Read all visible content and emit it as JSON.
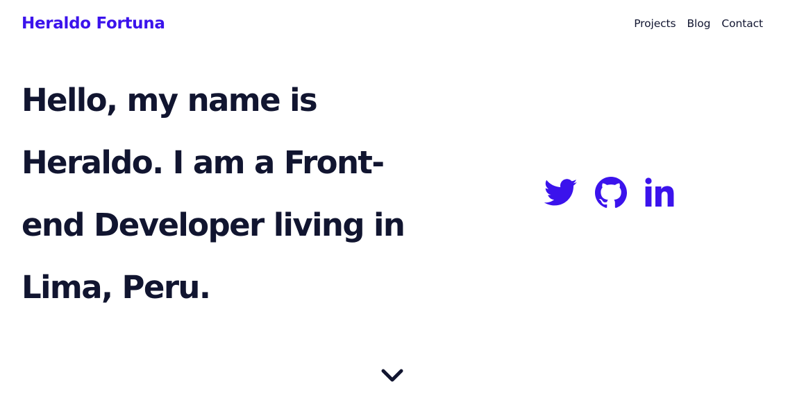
{
  "header": {
    "brand": "Heraldo Fortuna",
    "nav": [
      {
        "label": "Projects"
      },
      {
        "label": "Blog"
      },
      {
        "label": "Contact"
      }
    ]
  },
  "hero": {
    "lines": [
      "Hello, my name is",
      "Heraldo. I am a Front-",
      "end Developer living in",
      "Lima, Peru."
    ]
  },
  "socials": [
    {
      "icon": "twitter-icon"
    },
    {
      "icon": "github-icon"
    },
    {
      "icon": "linkedin-icon"
    }
  ],
  "scroll": {
    "icon": "chevron-down-icon"
  },
  "colors": {
    "accent": "#3b13ec",
    "text": "#111530",
    "background": "#ffffff"
  }
}
